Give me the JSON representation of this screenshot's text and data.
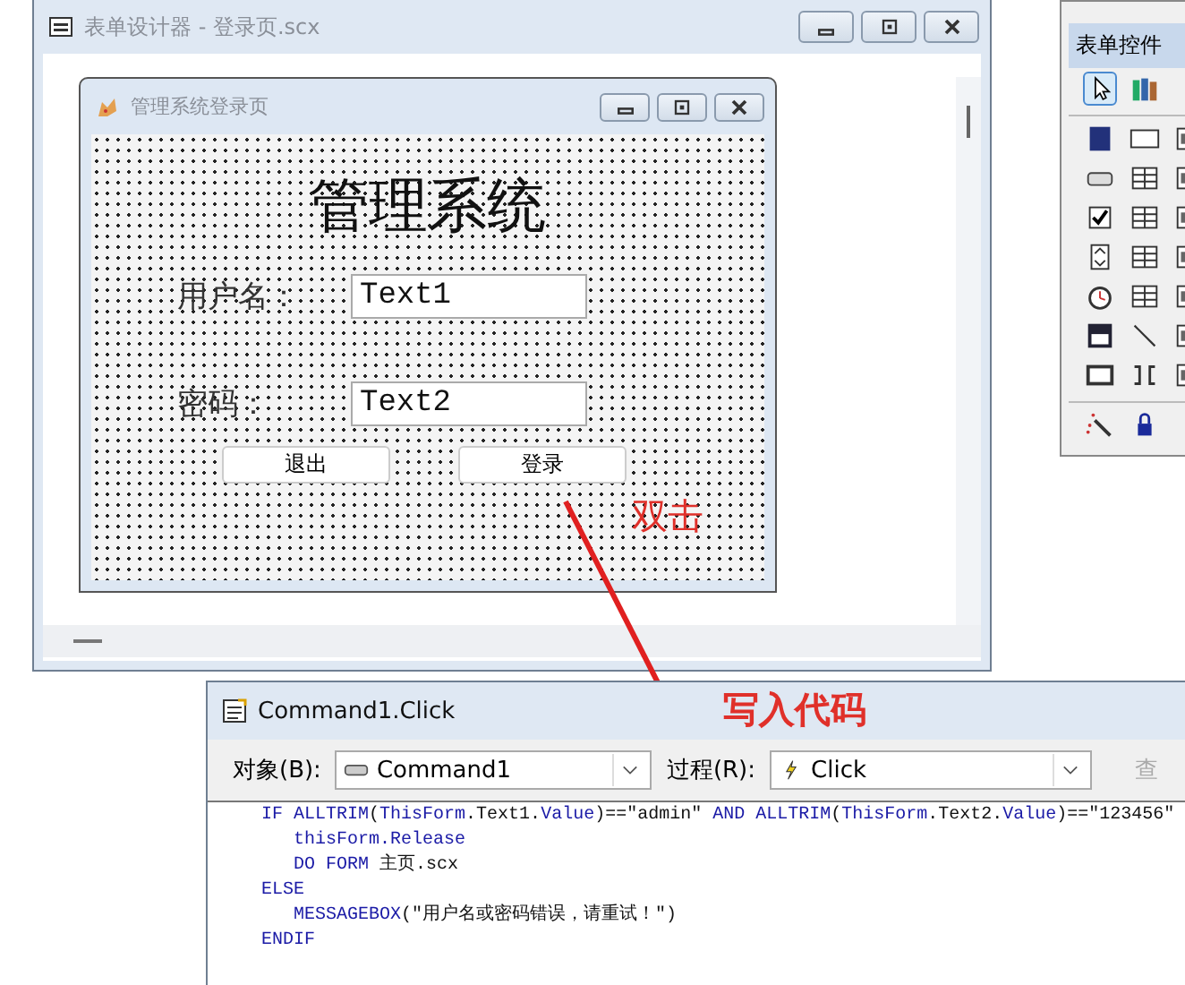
{
  "designer": {
    "title": "表单设计器 - 登录页.scx",
    "form": {
      "title": "管理系统登录页",
      "heading": "管理系统",
      "fields": [
        {
          "label": "用户名：",
          "value": "Text1"
        },
        {
          "label": "密码：",
          "value": "Text2"
        }
      ],
      "buttons": [
        "退出",
        "登录"
      ]
    }
  },
  "double_click_note": "双击",
  "toolbox": {
    "title": "表单控件"
  },
  "code_window": {
    "title": "Command1.Click",
    "note": "写入代码",
    "object_label": "对象(B):",
    "object_value": "Command1",
    "procedure_label": "过程(R):",
    "procedure_value": "Click",
    "view_button": "查",
    "lines": [
      {
        "segments": [
          {
            "kind": "keyword",
            "text": "IF ALLTRIM"
          },
          {
            "kind": "text",
            "text": "("
          },
          {
            "kind": "keyword",
            "text": "ThisForm"
          },
          {
            "kind": "text",
            "text": ".Text1."
          },
          {
            "kind": "keyword",
            "text": "Value"
          },
          {
            "kind": "text",
            "text": ")==\"admin\" "
          },
          {
            "kind": "keyword",
            "text": "AND ALLTRIM"
          },
          {
            "kind": "text",
            "text": "("
          },
          {
            "kind": "keyword",
            "text": "ThisForm"
          },
          {
            "kind": "text",
            "text": ".Text2."
          },
          {
            "kind": "keyword",
            "text": "Value"
          },
          {
            "kind": "text",
            "text": ")==\"123456\""
          }
        ]
      },
      {
        "indent": true,
        "segments": [
          {
            "kind": "keyword",
            "text": "thisForm.Release"
          }
        ]
      },
      {
        "indent": true,
        "segments": [
          {
            "kind": "keyword",
            "text": "DO FORM"
          },
          {
            "kind": "text",
            "text": " 主页.scx"
          }
        ]
      },
      {
        "segments": [
          {
            "kind": "keyword",
            "text": "ELSE"
          }
        ]
      },
      {
        "indent": true,
        "segments": [
          {
            "kind": "keyword",
            "text": "MESSAGEBOX"
          },
          {
            "kind": "text",
            "text": "(\"用户名或密码错误，请重试！\")"
          }
        ]
      },
      {
        "segments": [
          {
            "kind": "keyword",
            "text": "ENDIF"
          }
        ]
      }
    ]
  }
}
